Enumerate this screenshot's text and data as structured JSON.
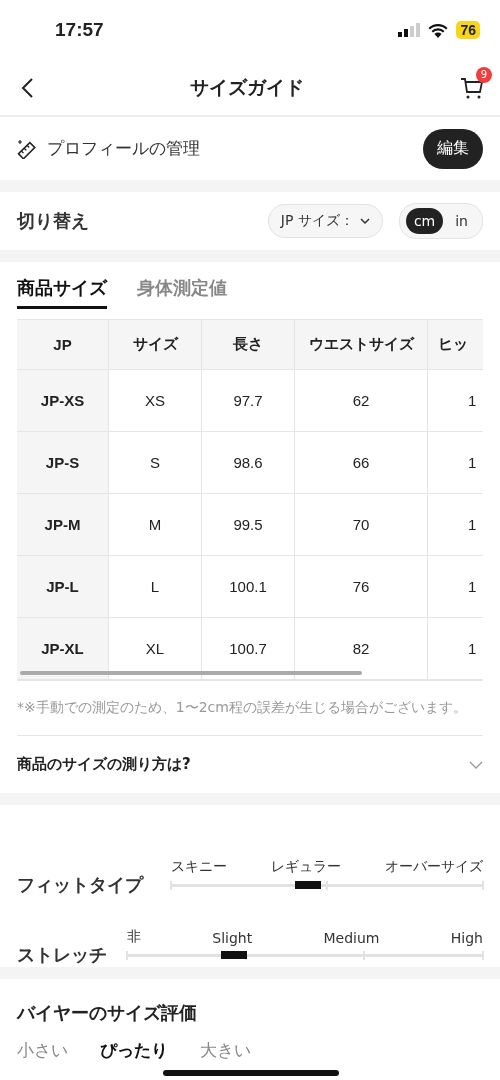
{
  "status_bar": {
    "time": "17:57",
    "battery": "76"
  },
  "nav": {
    "title": "サイズガイド",
    "cart_count": "9"
  },
  "profile": {
    "label": "プロフィールの管理",
    "button": "編集"
  },
  "switch": {
    "label": "切り替え",
    "size_system": "JP サイズ：",
    "units": [
      {
        "label": "cm",
        "selected": true
      },
      {
        "label": "in",
        "selected": false
      }
    ]
  },
  "tabs": [
    {
      "label": "商品サイズ",
      "selected": true
    },
    {
      "label": "身体測定値",
      "selected": false
    }
  ],
  "table": {
    "columns": [
      "JP",
      "サイズ",
      "長さ",
      "ウエストサイズ",
      "ヒッ"
    ],
    "rows": [
      [
        "JP-XS",
        "XS",
        "97.7",
        "62",
        "1"
      ],
      [
        "JP-S",
        "S",
        "98.6",
        "66",
        "1"
      ],
      [
        "JP-M",
        "M",
        "99.5",
        "70",
        "1"
      ],
      [
        "JP-L",
        "L",
        "100.1",
        "76",
        "1"
      ],
      [
        "JP-XL",
        "XL",
        "100.7",
        "82",
        "1"
      ]
    ]
  },
  "note": "*※手動での測定のため、1〜2cm程の誤差が生じる場合がございます。",
  "accordion": {
    "title": "商品のサイズの測り方は?",
    "expanded": false
  },
  "fit_scales": [
    {
      "label": "フィットタイプ",
      "options": [
        "スキニー",
        "レギュラー",
        "オーバーサイズ"
      ],
      "level": 0.44
    },
    {
      "label": "ストレッチ",
      "options": [
        "非",
        "Slight",
        "Medium",
        "High"
      ],
      "level": 0.3
    }
  ],
  "buyer_rating": {
    "title": "バイヤーのサイズ評価",
    "options": [
      "小さい",
      "ぴったり",
      "大きい"
    ]
  }
}
